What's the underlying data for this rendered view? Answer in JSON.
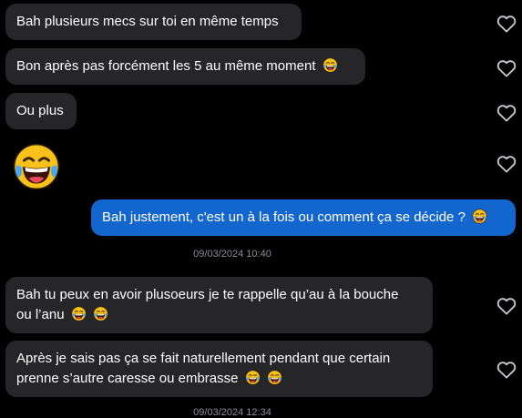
{
  "messages": [
    {
      "text": "Bah plusieurs mecs sur toi en même temps"
    },
    {
      "text": "Bon après pas forcément les 5 au même moment"
    },
    {
      "text": "Ou plus"
    },
    {
      "text": "Bah justement, c'est un à la fois ou comment ça se décide ?"
    },
    {
      "line1": "Bah tu peux en avoir plusoeurs je te rappelle qu’au à la bouche",
      "line2": "ou l’anu"
    },
    {
      "line1": "Après je sais pas ça se fait naturellement pendant que certain",
      "line2": "prenne s’autre caresse ou embrasse"
    }
  ],
  "timestamps": [
    "09/03/2024 10:40",
    "09/03/2024 12:34"
  ],
  "icons": {
    "emoji": "laughing-tears-emoji",
    "like": "heart-outline-icon"
  },
  "colors": {
    "incoming_bubble": "#262629",
    "outgoing_bubble": "#1466cf",
    "background": "#000000",
    "timestamp_text": "#8d8d93"
  }
}
